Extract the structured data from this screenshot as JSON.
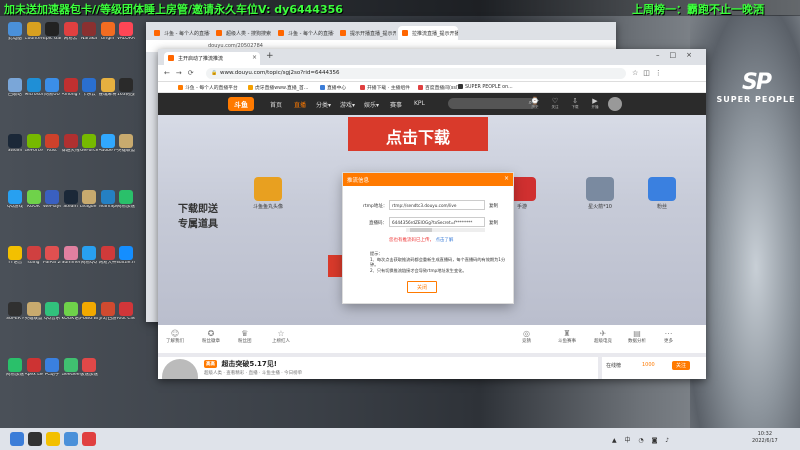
{
  "banner": {
    "left": "加未送加速器包卡//等级团体睡上房管/邀请永久车位V: dy6444356",
    "right": "上周榜一：霸跑不止一晚洒"
  },
  "brand_logo": {
    "mark": "SP",
    "text": "SUPER PEOPLE"
  },
  "desktop_icons": [
    {
      "label": "此电脑",
      "color": "#4a90d9"
    },
    {
      "label": "Counter-Strike",
      "color": "#d8a020"
    },
    {
      "label": "Epic Games Launcher",
      "color": "#222222"
    },
    {
      "label": "网易云",
      "color": "#e04040"
    },
    {
      "label": "Naraka",
      "color": "#8a3030"
    },
    {
      "label": "Origin",
      "color": "#f36c21"
    },
    {
      "label": "VALORANT",
      "color": "#ff4655"
    },
    {
      "label": "回收站",
      "color": "#7aa6d8"
    },
    {
      "label": "Microsoft Edge",
      "color": "#1f8fd6"
    },
    {
      "label": "网易UU",
      "color": "#3b8ee8"
    },
    {
      "label": "Among Us",
      "color": "#c03030"
    },
    {
      "label": "卡乐云",
      "color": "#2a6fd0"
    },
    {
      "label": "雀魂麻将 Mahjong Soul",
      "color": "#e6b040"
    },
    {
      "label": "163的战手游",
      "color": "#2a2a2a"
    },
    {
      "label": "Steam",
      "color": "#1b2838"
    },
    {
      "label": "GeForce Experience",
      "color": "#76b900"
    },
    {
      "label": "Rust",
      "color": "#cd412b"
    },
    {
      "label": "穿越火线2",
      "color": "#b03030"
    },
    {
      "label": "GeForce NOW",
      "color": "#76b900"
    },
    {
      "label": "Adobe Photoshop",
      "color": "#31a8ff"
    },
    {
      "label": "英雄联盟",
      "color": "#c8aa6e"
    },
    {
      "label": "QQ游戏",
      "color": "#28a0f0"
    },
    {
      "label": "KOOK",
      "color": "#6fd24a"
    },
    {
      "label": "WePlayer Engine",
      "color": "#3a60c0"
    },
    {
      "label": "Steam",
      "color": "#1b2838"
    },
    {
      "label": "League of Legends",
      "color": "#c8aa6e"
    },
    {
      "label": "TeamSpeak",
      "color": "#2580c3"
    },
    {
      "label": "网易加速器",
      "color": "#2ac06a"
    },
    {
      "label": "YY语音",
      "color": "#f3c000"
    },
    {
      "label": "slang",
      "color": "#d04040"
    },
    {
      "label": "PalPal 2D Loader",
      "color": "#e05050"
    },
    {
      "label": "Summer Party",
      "color": "#e080a0"
    },
    {
      "label": "网易QQ",
      "color": "#28a0f0"
    },
    {
      "label": "网易大神",
      "color": "#d03a3a"
    },
    {
      "label": "Battle.net",
      "color": "#148eff"
    },
    {
      "label": "SUPER PEOPLE CBT",
      "color": "#303030"
    },
    {
      "label": "英雄联盟 WeGame版",
      "color": "#c8aa6e"
    },
    {
      "label": "QQ音乐",
      "color": "#31c27c"
    },
    {
      "label": "KOOK语音",
      "color": "#6fd24a"
    },
    {
      "label": "PUBG BATTLEGROUNDS",
      "color": "#f2a900"
    },
    {
      "label": "梦幻西游",
      "color": "#d04a30"
    },
    {
      "label": "Riot Client",
      "color": "#d13639"
    },
    {
      "label": "网易加速器",
      "color": "#2ac06a"
    },
    {
      "label": "Apex Legends",
      "color": "#cd3333"
    },
    {
      "label": "PC助手",
      "color": "#3a80e0"
    },
    {
      "label": "GeeGee",
      "color": "#40c070"
    },
    {
      "label": "极速加速器",
      "color": "#e04848"
    }
  ],
  "back_window": {
    "tabs": [
      "斗鱼 - 每个人的直播平台",
      "超级人类 - 搜狗搜索",
      "斗鱼 - 每个人的直播平台",
      "提示开播直播_提示开播播…",
      "拉推流直播_提示开播播…"
    ],
    "url": "douyu.com/20502784"
  },
  "browser": {
    "tab_title": "主开启动了推流推流",
    "url": "www.douyu.com/topic/sgj2so?rid=6444356",
    "bookmarks": [
      "斗鱼 - 每个人的直播平台",
      "虎牙直播www.直播_首...",
      "直播中心",
      "开播下载 · 主播组件",
      "百度直播间(ssl)",
      "SUPER PEOPLE on..."
    ],
    "bookmark_colors": [
      "#ff7a00",
      "#f5a000",
      "#3b7dd8",
      "#e04040",
      "#e04040",
      "#333333"
    ]
  },
  "douyu": {
    "logo": "斗鱼",
    "nav": [
      "首页",
      "直播",
      "分类▾",
      "游戏▾",
      "娱乐▾",
      "赛事",
      "KPL"
    ],
    "user_icons": [
      "历史",
      "关注",
      "下载",
      "开播"
    ],
    "user_icon_glyphs": [
      "⌚",
      "♡",
      "⇩",
      "▶"
    ],
    "promo_top": "点击下载",
    "promo_left": [
      "下载即送",
      "专属道具"
    ],
    "promo_bottom": "报赛",
    "promo_items": [
      {
        "label": "斗鱼鱼丸头像",
        "color": "#e8a020"
      },
      {
        "label": "手游",
        "color": "#d03030"
      },
      {
        "label": "星火箭*10",
        "color": "#7a8aa0"
      },
      {
        "label": "粉丝",
        "color": "#3a80e0"
      }
    ],
    "room_row": [
      {
        "label": "了解我们",
        "glyph": "☺"
      },
      {
        "label": "粉丝徽章",
        "glyph": "✪"
      },
      {
        "label": "粉丝团",
        "glyph": "♛"
      },
      {
        "label": "上榜红人",
        "glyph": "☆"
      },
      {
        "label": "竞猜",
        "glyph": "◎"
      },
      {
        "label": "斗鱼赛事",
        "glyph": "♜"
      },
      {
        "label": "超级电竞",
        "glyph": "✈"
      },
      {
        "label": "数据分析",
        "glyph": "▤"
      },
      {
        "label": "更多",
        "glyph": "⋯"
      }
    ],
    "streamer_tag": "高高",
    "streamer_title": "超击突破5.17见!",
    "streamer_meta": "超级人类 · 查看精彩 · 直播 · 斗鱼主播 · 今日榜单",
    "follow_label": "关注",
    "rank_label": "在线榜",
    "rank_count": "1000"
  },
  "dialog": {
    "title": "推流信息",
    "close": "×",
    "rtmp_label": "rtmp地址：",
    "rtmp_value": "rtmp://sendtc3.douyu.com/live",
    "key_label": "直播码：",
    "key_value": "6444356rdZEIOGg?txSecret=f********",
    "copy_label": "复制",
    "warn": "您也有推流码已上传，",
    "warn_link": "点击了解",
    "notes": [
      "提示：",
      "1、每次点击获取推流码都会重新生成直播码，每个直播码的有效期为1分钟。",
      "2、只有切换推流链接才会导致rtmp地址发生变化。"
    ],
    "ok": "关闭"
  },
  "taskbar": {
    "apps": [
      "#3b7dd8",
      "#333333",
      "#f3c000",
      "#4a90d9",
      "#e04040"
    ],
    "app_names": [
      "windows",
      "search",
      "file-explorer",
      "chrome",
      "game"
    ],
    "tray": "▲ 中 ◔ ◙ ♪",
    "time": "10:32",
    "date": "2022/6/17"
  }
}
